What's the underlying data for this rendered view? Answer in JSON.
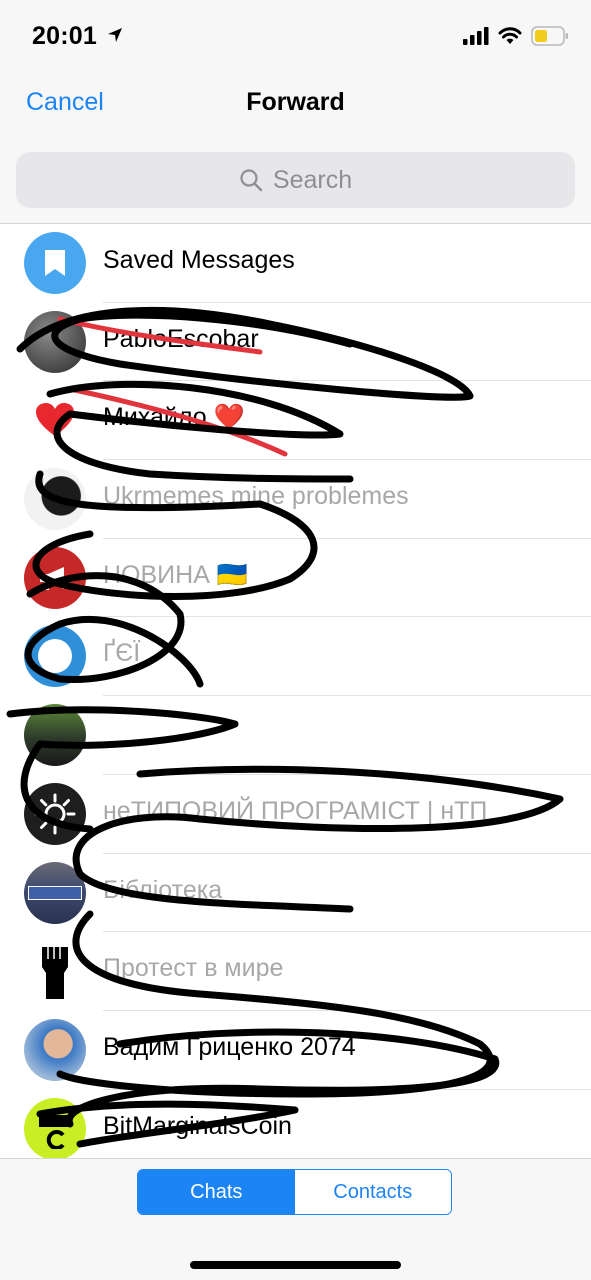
{
  "status": {
    "time": "20:01"
  },
  "nav": {
    "cancel_label": "Cancel",
    "title": "Forward"
  },
  "search": {
    "placeholder": "Search"
  },
  "chats": [
    {
      "name": "Saved Messages",
      "active": true,
      "avatar": "bookmark-icon"
    },
    {
      "name": "PabloEscobar",
      "active": true,
      "avatar": "photo"
    },
    {
      "name": "Михайло ❤️",
      "active": true,
      "avatar": "heart"
    },
    {
      "name": "Ukrmemes mine problemes",
      "active": false,
      "avatar": "photo"
    },
    {
      "name": "НОВИНА 🇺🇦",
      "active": false,
      "avatar": "megaphone"
    },
    {
      "name": "ҐЄЇ",
      "active": false,
      "avatar": "photo"
    },
    {
      "name": "",
      "active": false,
      "avatar": "photo"
    },
    {
      "name": "неТИПОВИЙ ПРОГРАМІСТ | нТП",
      "active": false,
      "avatar": "emblem"
    },
    {
      "name": "Бібліотека",
      "active": false,
      "avatar": "street-sign"
    },
    {
      "name": "Протест в мире",
      "active": false,
      "avatar": "fist-icon"
    },
    {
      "name": "Вадим Гриценко 2074",
      "active": true,
      "avatar": "photo"
    },
    {
      "name": "BitMarginalsCoin",
      "active": true,
      "avatar": "bmc"
    }
  ],
  "tabs": {
    "chats_label": "Chats",
    "contacts_label": "Contacts",
    "selected": "Chats"
  },
  "colors": {
    "accent": "#1d84f5",
    "saved_avatar": "#49a7f0",
    "background": "#f7f7f7"
  }
}
